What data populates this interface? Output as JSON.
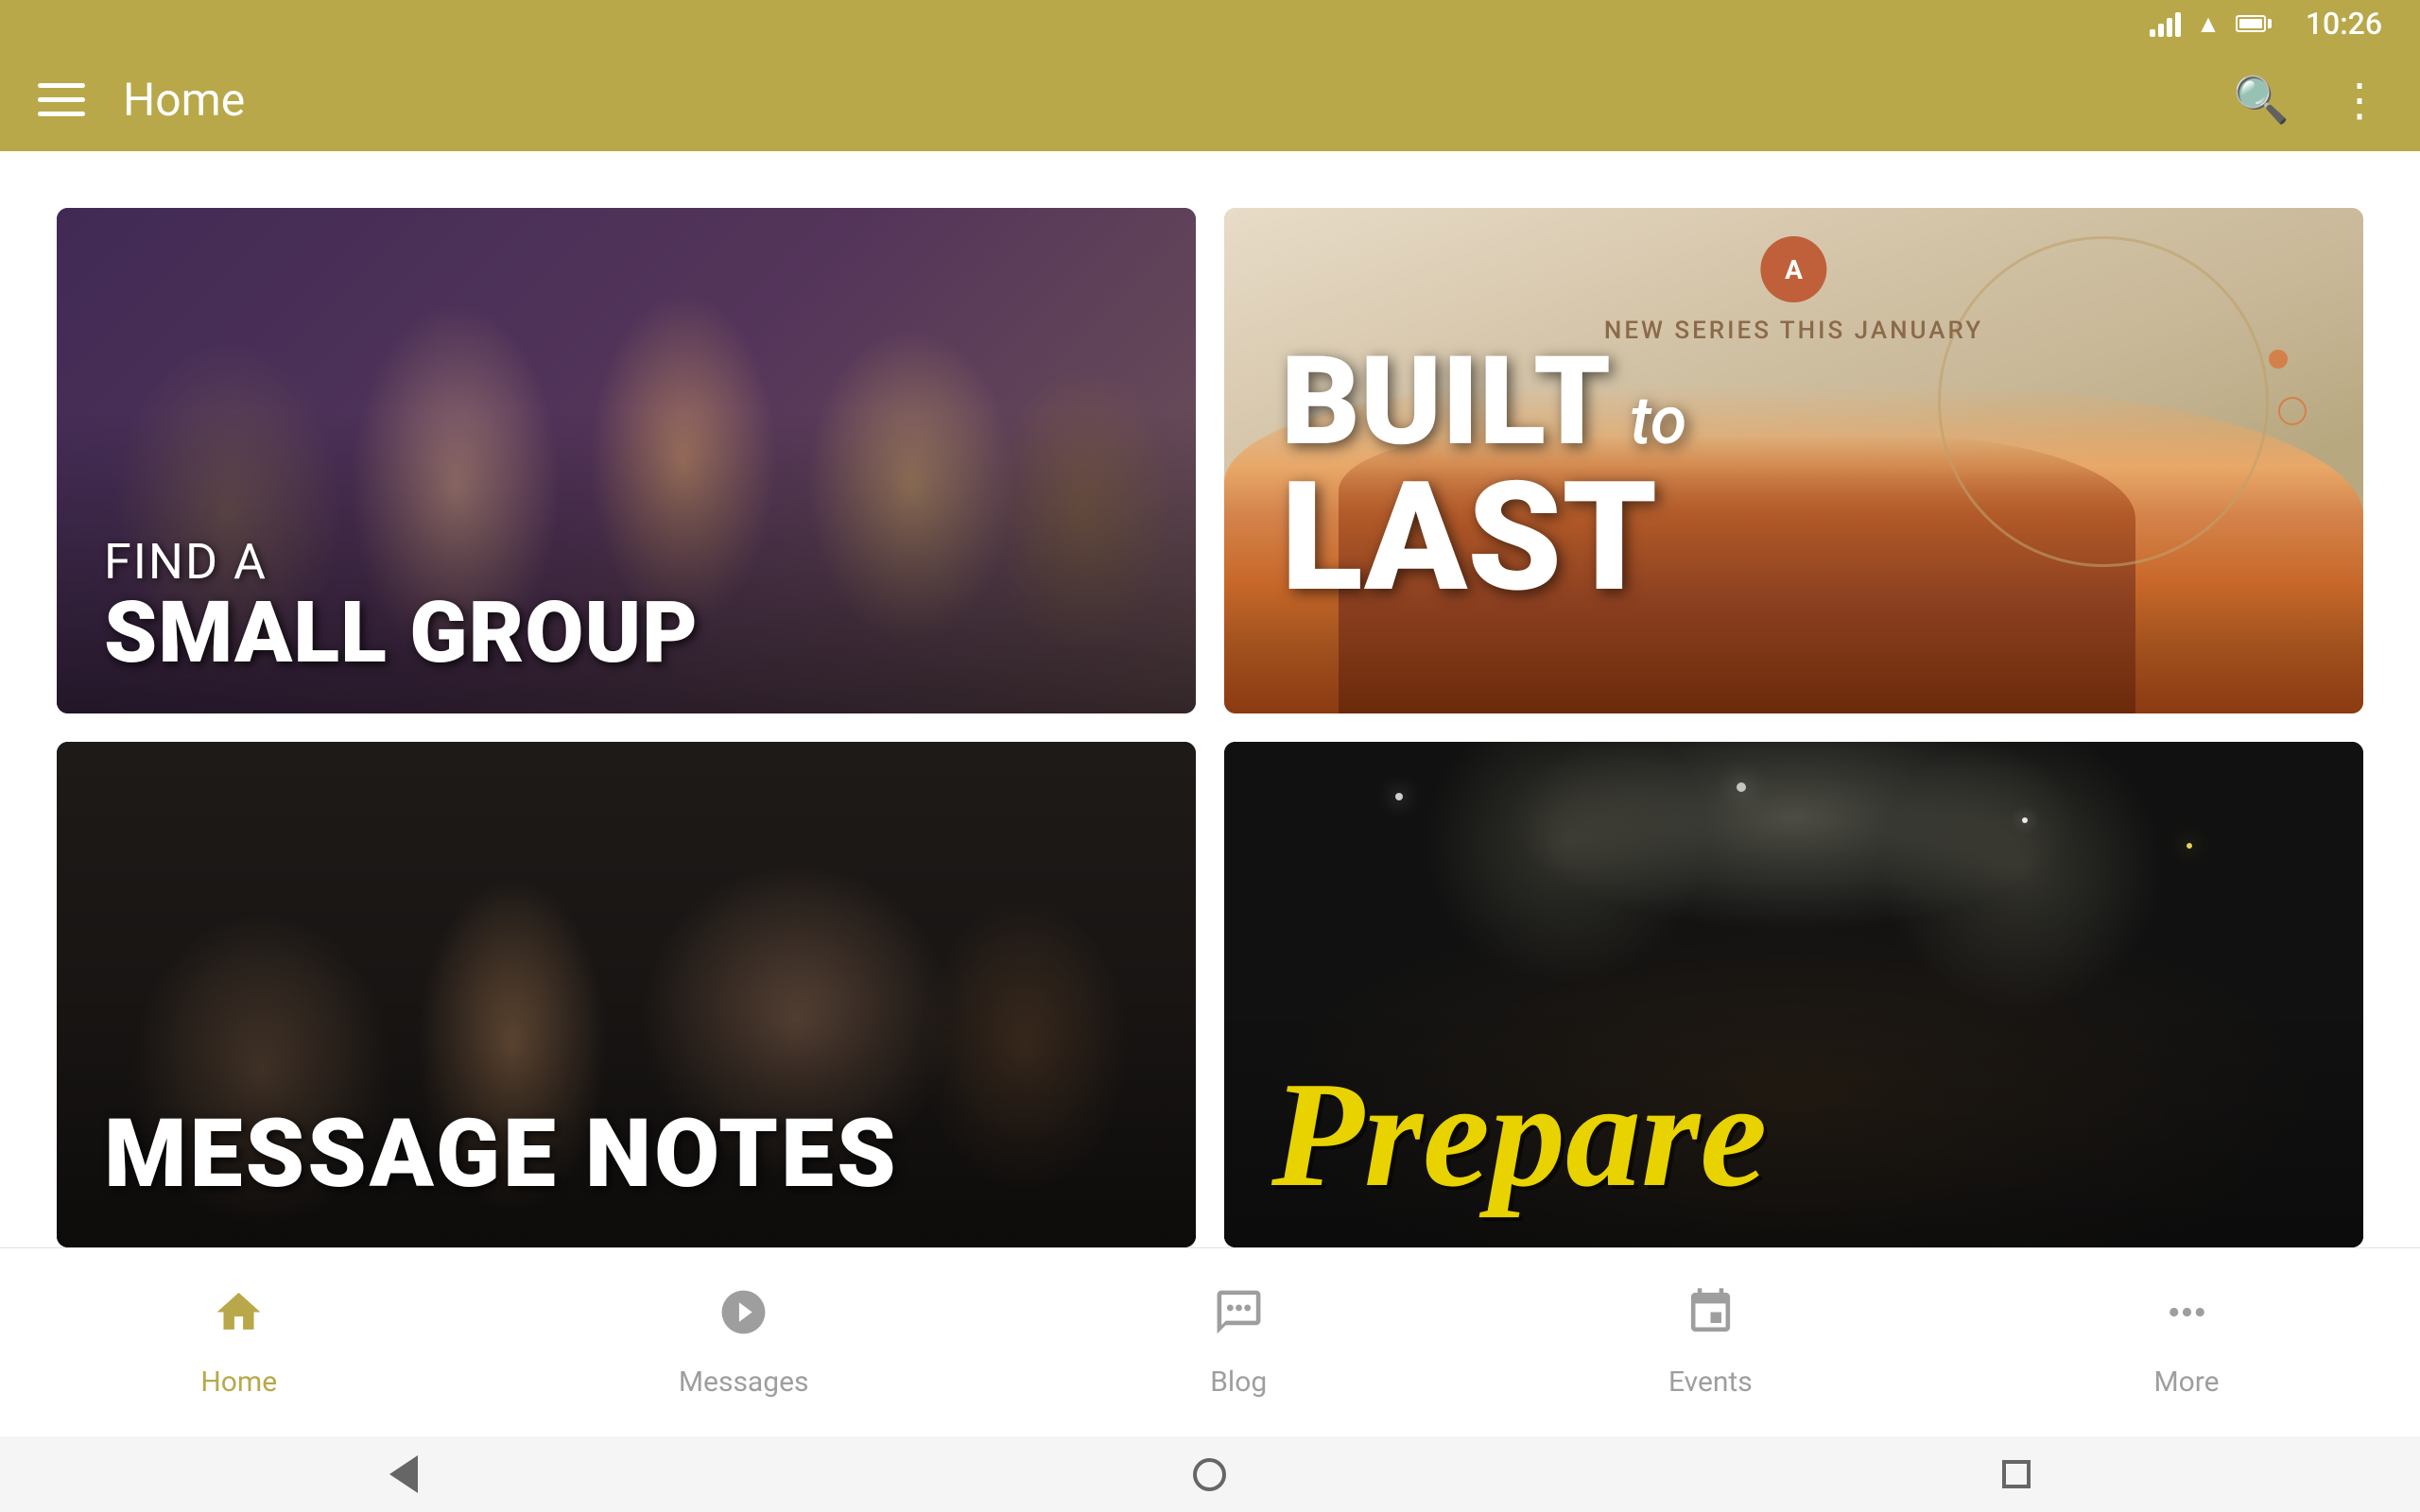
{
  "statusBar": {
    "time": "10:26"
  },
  "appBar": {
    "title": "Home",
    "menuIcon": "menu-icon",
    "searchIcon": "search-icon",
    "moreIcon": "more-vertical-icon"
  },
  "cards": [
    {
      "id": "small-group",
      "line1": "FIND A",
      "line2": "SMALL GROUP",
      "type": "people-photo"
    },
    {
      "id": "built-to-last",
      "newSeriesText": "NEW SERIES THIS JANUARY",
      "title1": "BUILT",
      "titleTo": "to",
      "title2": "LAST",
      "type": "desert-photo"
    },
    {
      "id": "message-notes",
      "label": "MESSAGE NOTES",
      "type": "students-photo"
    },
    {
      "id": "prepare",
      "label": "Prepare",
      "type": "concert-photo"
    }
  ],
  "bottomNav": {
    "items": [
      {
        "id": "home",
        "label": "Home",
        "icon": "home",
        "active": true
      },
      {
        "id": "messages",
        "label": "Messages",
        "icon": "play-circle",
        "active": false
      },
      {
        "id": "blog",
        "label": "Blog",
        "icon": "chat-bubble",
        "active": false
      },
      {
        "id": "events",
        "label": "Events",
        "icon": "calendar",
        "active": false
      },
      {
        "id": "more",
        "label": "More",
        "icon": "more-horizontal",
        "active": false
      }
    ]
  }
}
